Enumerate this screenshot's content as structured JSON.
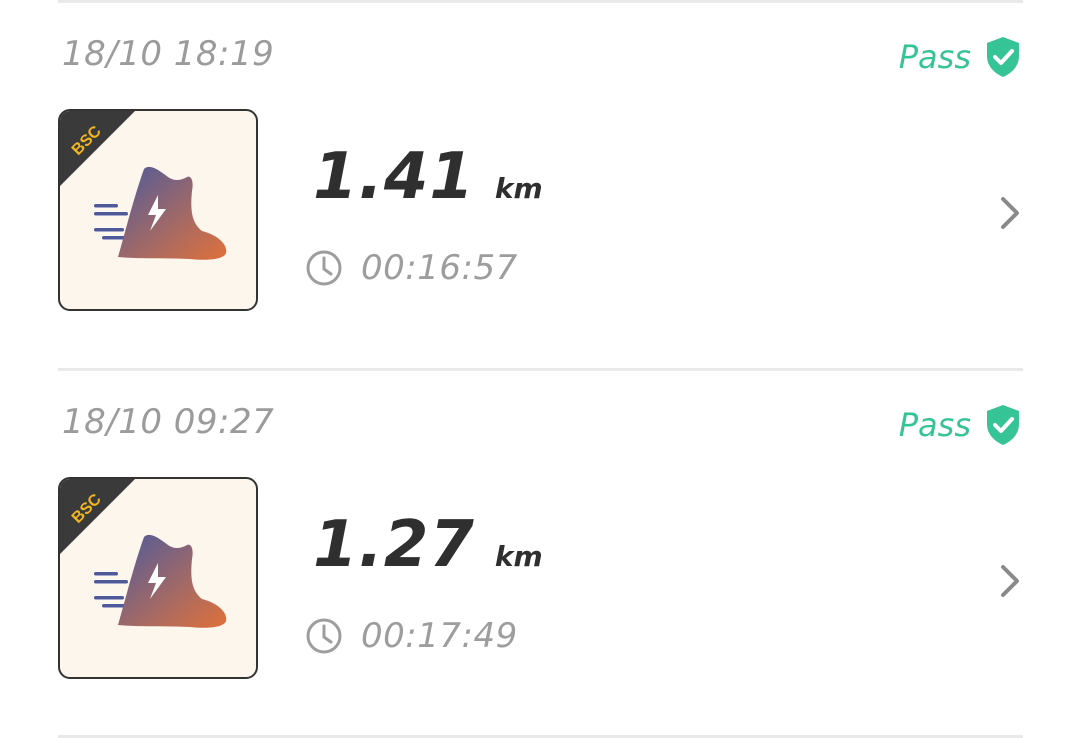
{
  "records": [
    {
      "timestamp": "18/10 18:19",
      "status": "Pass",
      "badge": "BSC",
      "distance": "1.41",
      "distance_unit": "km",
      "duration": "00:16:57"
    },
    {
      "timestamp": "18/10 09:27",
      "status": "Pass",
      "badge": "BSC",
      "distance": "1.27",
      "distance_unit": "km",
      "duration": "00:17:49"
    }
  ],
  "colors": {
    "status_pass": "#36c496",
    "text_primary": "#2f2f2f",
    "text_secondary": "#9b9b9b",
    "badge_ribbon": "#3a3a3a",
    "badge_text": "#f2b51d",
    "thumbnail_bg": "#fdf6ec"
  },
  "icons": {
    "status": "shield-check-icon",
    "thumbnail": "running-shoe-icon",
    "duration": "clock-icon",
    "navigate": "chevron-right-icon"
  }
}
